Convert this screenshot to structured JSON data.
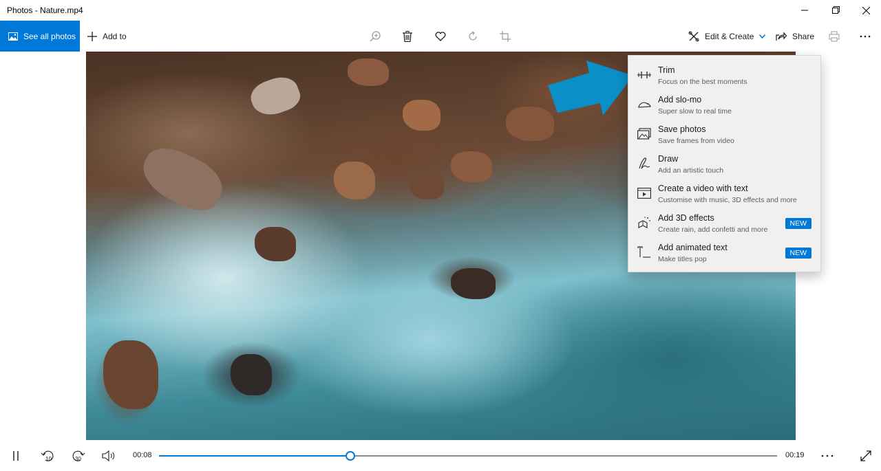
{
  "window": {
    "title": "Photos - Nature.mp4"
  },
  "toolbar": {
    "see_all": "See all photos",
    "add_to": "Add to",
    "edit_create": "Edit & Create",
    "share": "Share",
    "icons": [
      "zoom-in-icon",
      "delete-icon",
      "heart-icon",
      "rotate-icon",
      "crop-icon",
      "print-icon",
      "more-icon"
    ]
  },
  "menu": {
    "items": [
      {
        "title": "Trim",
        "subtitle": "Focus on the best moments",
        "icon": "trim-icon",
        "badge": ""
      },
      {
        "title": "Add slo-mo",
        "subtitle": "Super slow to real time",
        "icon": "slomo-icon",
        "badge": ""
      },
      {
        "title": "Save photos",
        "subtitle": "Save frames from video",
        "icon": "save-photos-icon",
        "badge": ""
      },
      {
        "title": "Draw",
        "subtitle": "Add an artistic touch",
        "icon": "draw-icon",
        "badge": ""
      },
      {
        "title": "Create a video with text",
        "subtitle": "Customise with music, 3D effects and more",
        "icon": "video-text-icon",
        "badge": ""
      },
      {
        "title": "Add 3D effects",
        "subtitle": "Create rain, add confetti and more",
        "icon": "3d-effects-icon",
        "badge": "NEW"
      },
      {
        "title": "Add animated text",
        "subtitle": "Make titles pop",
        "icon": "animated-text-icon",
        "badge": "NEW"
      }
    ]
  },
  "player": {
    "current_time": "00:08",
    "total_time": "00:19",
    "progress": 0.31,
    "skip_back_label": "10",
    "skip_forward_label": "30"
  },
  "colors": {
    "accent": "#0078d7",
    "pointer": "#0a8fc7"
  }
}
